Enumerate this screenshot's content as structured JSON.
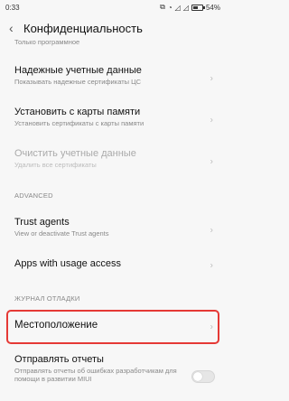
{
  "status_bar": {
    "time": "0:33",
    "battery": "54%",
    "battery_level": 0.54
  },
  "header": {
    "back": "‹",
    "title": "Конфиденциальность"
  },
  "top_sub": "Только программное",
  "items": [
    {
      "title": "Надежные учетные данные",
      "subtitle": "Показывать надежные сертификаты ЦС"
    },
    {
      "title": "Установить с карты памяти",
      "subtitle": "Установить сертификаты с карты памяти"
    },
    {
      "title": "Очистить учетные данные",
      "subtitle": "Удалить все сертификаты"
    }
  ],
  "section_advanced": "ADVANCED",
  "advanced_items": [
    {
      "title": "Trust agents",
      "subtitle": "View or deactivate Trust agents"
    },
    {
      "title": "Apps with usage access"
    }
  ],
  "section_debug": "ЖУРНАЛ ОТЛАДКИ",
  "debug_items": [
    {
      "title": "Местоположение"
    },
    {
      "title": "Отправлять отчеты",
      "subtitle": "Отправлять отчеты об ошибках разработчикам для помощи в развитии MIUI",
      "toggle_on": false
    }
  ],
  "chevron": "›"
}
